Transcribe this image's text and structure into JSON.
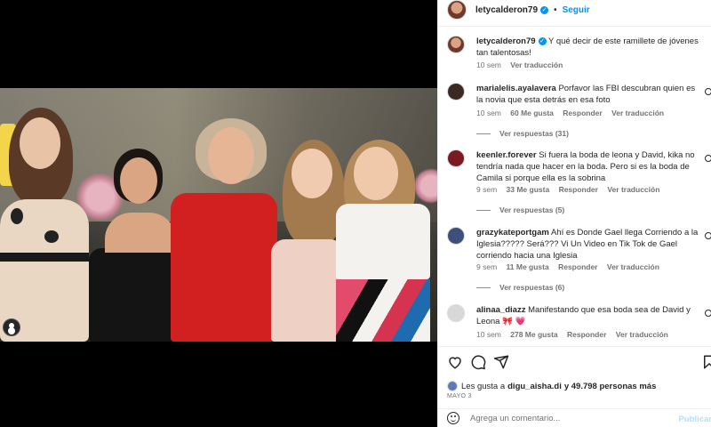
{
  "post": {
    "author": "letycalderon79",
    "follow_label": "Seguir",
    "caption": "Y qué decir de este ramillete de jóvenes tan talentosas!",
    "caption_time": "10 sem",
    "see_translation": "Ver traducción"
  },
  "comments": [
    {
      "user": "marialelis.ayalavera",
      "text": "Porfavor las FBI descubran quien es la novia que esta detrás en esa foto",
      "time": "10 sem",
      "likes": "60 Me gusta",
      "reply": "Responder",
      "translate": "Ver traducción",
      "replies": "Ver respuestas (31)",
      "avatar_color": "#3a2a22"
    },
    {
      "user": "keenler.forever",
      "text": "Si fuera la boda de leona y David, kika no tendría nada que hacer en la boda. Pero si es la boda de Camila si porque ella es la sobrina",
      "time": "9 sem",
      "likes": "33 Me gusta",
      "reply": "Responder",
      "translate": "Ver traducción",
      "replies": "Ver respuestas (5)",
      "avatar_color": "#7a1a22"
    },
    {
      "user": "grazykateportgam",
      "text": "Ahí es Donde Gael llega Corriendo a la Iglesia????? Será??? Vi Un Video en Tik Tok de Gael corriendo hacia una Iglesia",
      "time": "9 sem",
      "likes": "11 Me gusta",
      "reply": "Responder",
      "translate": "Ver traducción",
      "replies": "Ver respuestas (6)",
      "avatar_color": "#3d4f7a"
    },
    {
      "user": "alinaa_diazz",
      "text": "Manifestando que esa boda sea de David y Leona 🎀 💗",
      "time": "10 sem",
      "likes": "278 Me gusta",
      "reply": "Responder",
      "translate": "Ver traducción",
      "replies": "",
      "avatar_color": "#d8d8d8"
    }
  ],
  "likes": {
    "prefix": "Les gusta a",
    "user": "digu_aisha.di",
    "suffix": "y 49.798 personas más"
  },
  "date": "MAYO 3",
  "add_comment": {
    "placeholder": "Agrega un comentario...",
    "publish": "Publicar"
  },
  "icons": [
    "heart-icon",
    "comment-icon",
    "share-icon",
    "bookmark-icon",
    "emoji-icon",
    "verified-icon",
    "user-tag-icon"
  ],
  "colors": {
    "accent": "#0095f6",
    "muted": "#737373",
    "text": "#262626"
  }
}
